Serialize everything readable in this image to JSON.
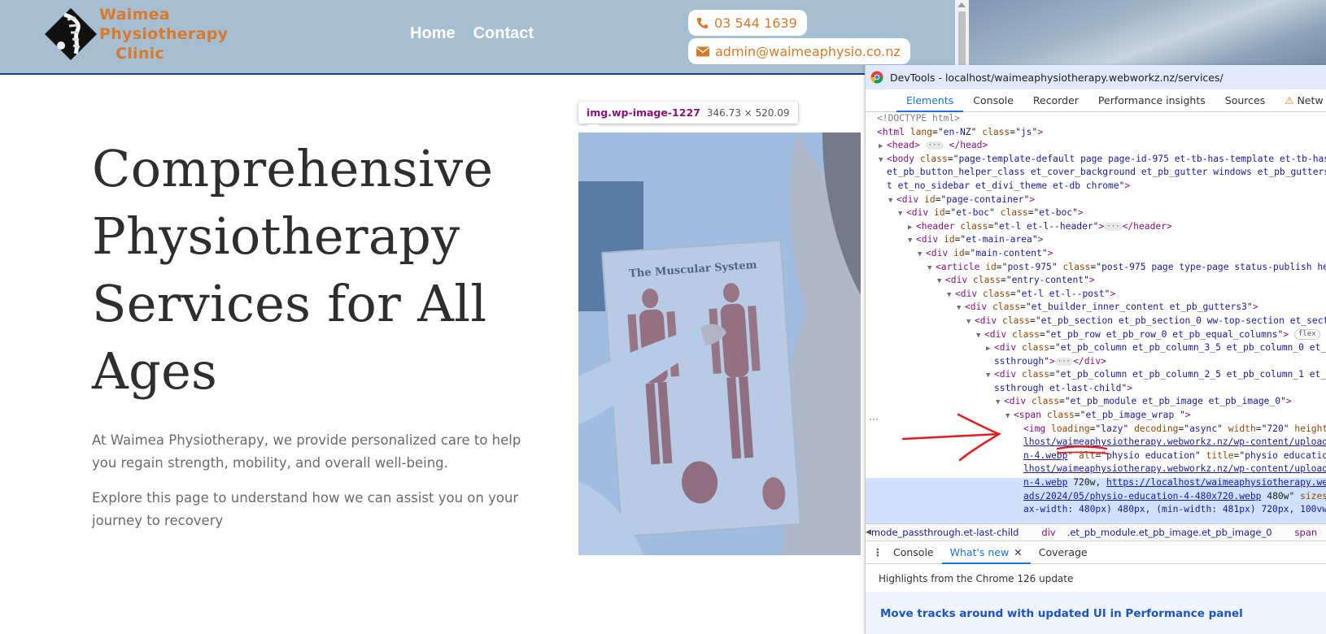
{
  "site": {
    "logo_lines": [
      "Waimea",
      "Physiotherapy",
      "Clinic"
    ],
    "nav": [
      "Home",
      "Contact"
    ],
    "phone": "03 544 1639",
    "email": "admin@waimeaphysio.co.nz"
  },
  "hero": {
    "title_lines": [
      "Comprehensive",
      "Physiotherapy",
      "Services for All",
      "Ages"
    ],
    "paragraph_1": "At Waimea Physiotherapy, we provide personalized care to help you regain strength, mobility, and overall well-being.",
    "paragraph_2": "Explore this page to understand how we can assist you on your journey to recovery"
  },
  "inspect_tooltip": {
    "selector": "img.wp-image-1227",
    "dimensions": "346.73 × 520.09"
  },
  "photo": {
    "poster_title": "The Muscular System",
    "alt": "physio education"
  },
  "devtools": {
    "title": "DevTools - localhost/waimeaphysiotherapy.webworkz.nz/services/",
    "tabs": [
      "Elements",
      "Console",
      "Recorder",
      "Performance insights",
      "Sources",
      "Netw"
    ],
    "active_tab": "Elements",
    "breadcrumb": [
      {
        "tag": "",
        "cls": "mode_passthrough.et-last-child"
      },
      {
        "tag": "div",
        "cls": ".et_pb_module.et_pb_image.et_pb_image_0"
      },
      {
        "tag": "span",
        "cls": ".et_pb_image_w"
      }
    ],
    "drawer_tabs": [
      "Console",
      "What's new",
      "Coverage"
    ],
    "drawer_active": "What's new",
    "whatsnew_heading": "Highlights from the Chrome 126 update",
    "whatsnew_link": "Move tracks around with updated UI in Performance panel"
  },
  "colors": {
    "header_bg": "#a6bed1",
    "brand_orange": "#d9792a",
    "devtools_blue": "#1a73e8"
  }
}
